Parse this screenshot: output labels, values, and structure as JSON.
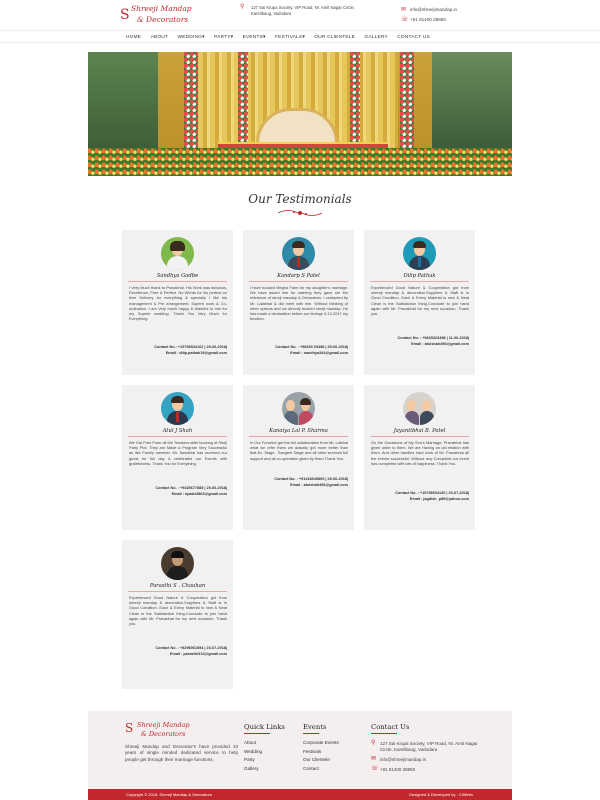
{
  "brand": {
    "name_line1": "Shreeji Mandap",
    "name_line2": "& Decorators",
    "mark": "S"
  },
  "header": {
    "address": "127 Sai Krupa Society, VIP Road, Nr. Amit Nagar Circle, Karelibaug, Vadodara",
    "email": "info@shreejimandap.in",
    "phone": "+91 81400 28850"
  },
  "nav": [
    "HOME",
    "ABOUT",
    "WEDDING",
    "PARTY",
    "EVENTS",
    "FESTIVALS",
    "OUR CLIENTELE",
    "GALLERY",
    "CONTACT US"
  ],
  "testimonials": {
    "title": "Our Testimonials",
    "items": [
      {
        "name": "Sandhya Godbe",
        "body": "I Very Much thank to Pravabhai. His Work was fabulous, Excellence, Pure & Perfect. No Words for his perfect on time Delivery for everything & specially I like his management & Pre arrangement. Superb work & Co-ordination. I am Very much happy & thankful to him for my Superb wedding. Thank You Very Much for Everything.",
        "contact": "Contact No.: +15708534102 | 29-06-2018|",
        "email": "Email : dilip.pathak19@gmail.com"
      },
      {
        "name": "Kandarp S Patel",
        "body": "I have booked Megha Farm for my daughter's marriage. We have asked him for catering they gave me the reference of shreji mandap & Decorators. I contacted by Mr. Lalabhai & did meet with him. Without thinking of other options and we directly booked shreji mandap. He has made a declaration before our timings 9-12-2017 my function.",
        "contact": "Contact No. : +98253 03498 | 29-06-2018|",
        "email": "Email : sandhya344@gmail.com"
      },
      {
        "name": "Dilip Pathak",
        "body": "Experienced Good Nature & Cooperation got from shreeji mandap & decoration.Suppliers & Staff is in Good Condition. Each & Every Material is new & Neat Clean is the Satisfaction thing.Conclude to join hand again with Mr. Pravabhai for my next occasion. Thank you.",
        "contact": "Contact No. : +9825323498 | 11-06-2018|",
        "email": "Email : atulshah496@gmail.com"
      },
      {
        "name": "Atul J Shah",
        "body": "We Got Free From all the Tensions after booking of Shriji Party Plot. They are Made a Program Very Successful as like Family member. Mr. Natubhai has received our guest for full day & celebrated our Events with gratefulness. Thank You for Everything.",
        "contact": "Contact No. : +9425677885 | 29-06-2018|",
        "email": "Email : kpatel2863@gmail.com"
      },
      {
        "name": "Kanaiya Lal P. Sharma",
        "body": "In Our Function get the full collaboration from Mr. Lalbhai what we refer them we actually got more better than that.Ex. Stage , Sangeet Stage and all other services full support and all co-operation given by them.Thank You.",
        "contact": "Contact No. : +91418649869 | 29-06-2018|",
        "email": "Email : atulshah496@gmail.com"
      },
      {
        "name": "Jayantibhai B. Patel",
        "body": "On the Occasions of My Son's Marriage, Pravabhai has given order to them. We are Having an old relation with them. And other handles hard work of Mr. Pravabhai all the events successful. Without any Complaint our event has completed with lots of happiness. Thank You.",
        "contact": "Contact No. : +15708534130 | 23-07-2018|",
        "email": "Email : jagdish_p89@yahoo.com"
      },
      {
        "name": "Parasthi S . Chauhan",
        "body": "Experienced Good Nature & Cooperation got from shreeji mandap & decoration.Suppliers & Staff is in Good Condition. Each & Every Material is new & Neat Clean is the Satisfaction thing.Conclude to join hand again with Mr. Pravabhai for my next occasion. Thank you.",
        "contact": "Contact No. : +8296961694 | 23-07-2018|",
        "email": "Email : parasthi313@gmail.com"
      }
    ]
  },
  "footer": {
    "description": "Shreeji Mandap and Decorator's have provided 10 years of single minded dedicated service to help people get through their marriage functions.",
    "quick_links_title": "Quick Links",
    "quick_links": [
      "About",
      "Wedding",
      "Party",
      "Gallery"
    ],
    "events_title": "Events",
    "events": [
      "Corporate Events",
      "Festivals",
      "Our Clientele",
      "Contact"
    ],
    "contact_title": "Contact Us",
    "address": "127 Sai Krupa Society, VIP Road, Nr. Amit Nagar Circle, Karelibaug, Vadodara",
    "email": "info@shreejimandap.in",
    "phone": "+91 81400 28850",
    "copyright": "Copyright © 2018, Shreeji Mandap & Decorators",
    "designed_by": "Designed & Developed by : CIWebs"
  },
  "colors": {
    "accent": "#c0282d",
    "card_bg": "#f1f1f1",
    "footer_bg": "#f4eeee"
  }
}
